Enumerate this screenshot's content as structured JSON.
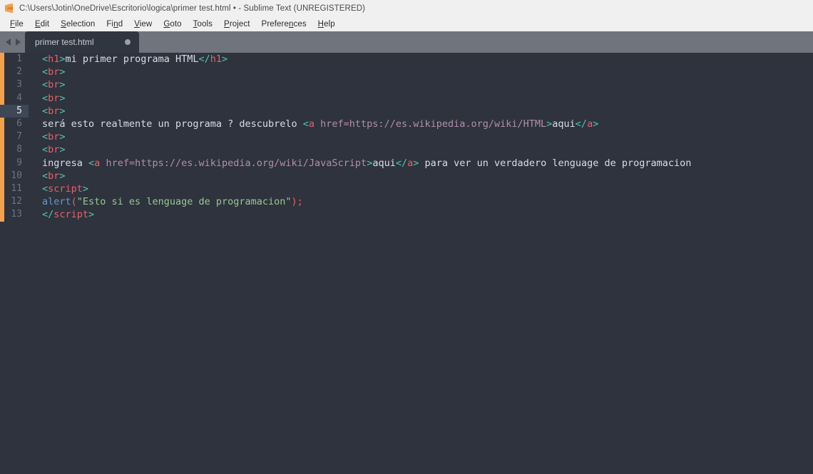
{
  "window": {
    "title": "C:\\Users\\Jotin\\OneDrive\\Escritorio\\logica\\primer test.html • - Sublime Text (UNREGISTERED)",
    "logo_icon": "sublime-text-logo-icon",
    "accent_color": "#f5a04b",
    "titlebar_bg": "#f0f0f0",
    "tabbar_bg": "#70747c",
    "editor_bg": "#2e333d"
  },
  "menubar": {
    "items": [
      {
        "label": "File",
        "pre": "",
        "accel": "F",
        "post": "ile"
      },
      {
        "label": "Edit",
        "pre": "",
        "accel": "E",
        "post": "dit"
      },
      {
        "label": "Selection",
        "pre": "",
        "accel": "S",
        "post": "election"
      },
      {
        "label": "Find",
        "pre": "Fi",
        "accel": "n",
        "post": "d"
      },
      {
        "label": "View",
        "pre": "",
        "accel": "V",
        "post": "iew"
      },
      {
        "label": "Goto",
        "pre": "",
        "accel": "G",
        "post": "oto"
      },
      {
        "label": "Tools",
        "pre": "",
        "accel": "T",
        "post": "ools"
      },
      {
        "label": "Project",
        "pre": "",
        "accel": "P",
        "post": "roject"
      },
      {
        "label": "Preferences",
        "pre": "Prefere",
        "accel": "n",
        "post": "ces"
      },
      {
        "label": "Help",
        "pre": "",
        "accel": "H",
        "post": "elp"
      }
    ]
  },
  "tabbar": {
    "nav_back_icon": "chevron-left-icon",
    "nav_forward_icon": "chevron-right-icon",
    "tabs": [
      {
        "label": "primer test.html",
        "dirty": true,
        "dirty_icon": "unsaved-dot-icon",
        "active": true
      }
    ]
  },
  "editor": {
    "active_line": 5,
    "total_lines": 13,
    "lines": [
      {
        "n": "1",
        "tokens": [
          {
            "t": "<",
            "c": "punct"
          },
          {
            "t": "h1",
            "c": "tag"
          },
          {
            "t": ">",
            "c": "punct"
          },
          {
            "t": "mi primer programa HTML",
            "c": "txt"
          },
          {
            "t": "</",
            "c": "punct"
          },
          {
            "t": "h1",
            "c": "tag"
          },
          {
            "t": ">",
            "c": "punct"
          }
        ]
      },
      {
        "n": "2",
        "tokens": [
          {
            "t": "<",
            "c": "punct"
          },
          {
            "t": "br",
            "c": "tag"
          },
          {
            "t": ">",
            "c": "punct"
          }
        ]
      },
      {
        "n": "3",
        "tokens": [
          {
            "t": "<",
            "c": "punct"
          },
          {
            "t": "br",
            "c": "tag"
          },
          {
            "t": ">",
            "c": "punct"
          }
        ]
      },
      {
        "n": "4",
        "tokens": [
          {
            "t": "<",
            "c": "punct"
          },
          {
            "t": "br",
            "c": "tag"
          },
          {
            "t": ">",
            "c": "punct"
          }
        ]
      },
      {
        "n": "5",
        "tokens": [
          {
            "t": "<",
            "c": "punct"
          },
          {
            "t": "br",
            "c": "tag"
          },
          {
            "t": ">",
            "c": "punct"
          }
        ]
      },
      {
        "n": "6",
        "tokens": [
          {
            "t": "será esto realmente un programa ? descubrelo ",
            "c": "txt"
          },
          {
            "t": "<",
            "c": "punct"
          },
          {
            "t": "a",
            "c": "tag"
          },
          {
            "t": " href=https://es.wikipedia.org/wiki/HTML",
            "c": "attr"
          },
          {
            "t": ">",
            "c": "punct"
          },
          {
            "t": "aqui",
            "c": "txt"
          },
          {
            "t": "</",
            "c": "punct"
          },
          {
            "t": "a",
            "c": "tag"
          },
          {
            "t": ">",
            "c": "punct"
          }
        ]
      },
      {
        "n": "7",
        "tokens": [
          {
            "t": "<",
            "c": "punct"
          },
          {
            "t": "br",
            "c": "tag"
          },
          {
            "t": ">",
            "c": "punct"
          }
        ]
      },
      {
        "n": "8",
        "tokens": [
          {
            "t": "<",
            "c": "punct"
          },
          {
            "t": "br",
            "c": "tag"
          },
          {
            "t": ">",
            "c": "punct"
          }
        ]
      },
      {
        "n": "9",
        "tokens": [
          {
            "t": "ingresa ",
            "c": "txt"
          },
          {
            "t": "<",
            "c": "punct"
          },
          {
            "t": "a",
            "c": "tag"
          },
          {
            "t": " href=https://es.wikipedia.org/wiki/JavaScript",
            "c": "attr"
          },
          {
            "t": ">",
            "c": "punct"
          },
          {
            "t": "aqui",
            "c": "txt"
          },
          {
            "t": "</",
            "c": "punct"
          },
          {
            "t": "a",
            "c": "tag"
          },
          {
            "t": ">",
            "c": "punct"
          },
          {
            "t": " para ver un verdadero lenguage de programacion",
            "c": "txt"
          }
        ]
      },
      {
        "n": "10",
        "tokens": [
          {
            "t": "<",
            "c": "punct"
          },
          {
            "t": "br",
            "c": "tag"
          },
          {
            "t": ">",
            "c": "punct"
          }
        ]
      },
      {
        "n": "11",
        "tokens": [
          {
            "t": "<",
            "c": "punct"
          },
          {
            "t": "script",
            "c": "tag"
          },
          {
            "t": ">",
            "c": "punct"
          }
        ]
      },
      {
        "n": "12",
        "tokens": [
          {
            "t": "alert",
            "c": "fn"
          },
          {
            "t": "(",
            "c": "paren"
          },
          {
            "t": "\"Esto si es lenguage de programacion\"",
            "c": "str"
          },
          {
            "t": ")",
            "c": "paren"
          },
          {
            "t": ";",
            "c": "paren"
          }
        ]
      },
      {
        "n": "13",
        "tokens": [
          {
            "t": "</",
            "c": "punct"
          },
          {
            "t": "script",
            "c": "tag"
          },
          {
            "t": ">",
            "c": "punct"
          }
        ]
      }
    ]
  }
}
